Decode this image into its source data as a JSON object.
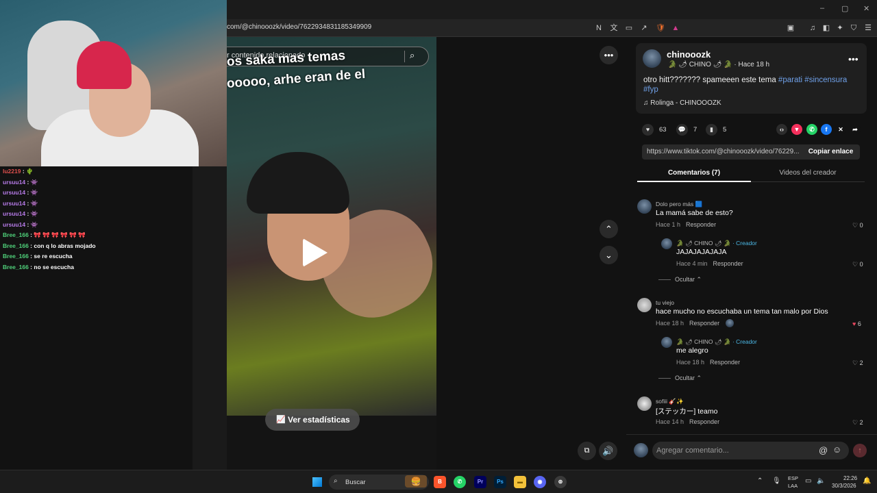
{
  "browser": {
    "url": "com/@chinooozk/video/7622934831185349909",
    "window_controls": [
      "–",
      "▢",
      "✕"
    ]
  },
  "chat": [
    {
      "user": "lu2219",
      "msg": "🌵",
      "color": "#e0504d"
    },
    {
      "user": "ursuu14",
      "msg": "👾",
      "color": "#b77be8"
    },
    {
      "user": "ursuu14",
      "msg": "👾",
      "color": "#b77be8"
    },
    {
      "user": "ursuu14",
      "msg": "👾",
      "color": "#b77be8"
    },
    {
      "user": "ursuu14",
      "msg": "👾",
      "color": "#b77be8"
    },
    {
      "user": "ursuu14",
      "msg": "👾",
      "color": "#b77be8"
    },
    {
      "user": "Bree_166",
      "msg": "🎀 🎀 🎀 🎀 🎀 🎀",
      "color": "#4fd17a"
    },
    {
      "user": "Bree_166",
      "msg": "con q lo abras mojado",
      "color": "#4fd17a"
    },
    {
      "user": "Bree_166",
      "msg": "se re escucha",
      "color": "#4fd17a"
    },
    {
      "user": "Bree_166",
      "msg": "no se escucha",
      "color": "#4fd17a"
    }
  ],
  "video": {
    "related_search": "r contenido relacionado",
    "caption_line1": "os saka mas temas",
    "caption_line2": "ooooo, arhe eran de el",
    "stats_button": "Ver estadísticas"
  },
  "post": {
    "author": "chinooozk",
    "author_sub": "🐊 🌶 CHINO 🌶 🐊 · Hace 18 h",
    "desc_text": "otro hitt??????? spameeen este tema ",
    "tags": [
      "#parati",
      "#sincensura",
      "#fyp"
    ],
    "music": "Rolinga - CHINOOOZK",
    "likes": "63",
    "comments": "7",
    "saves": "5",
    "link": "https://www.tiktok.com/@chinooozk/video/76229...",
    "copy_label": "Copiar enlace"
  },
  "tabs": {
    "comments": "Comentarios (7)",
    "videos": "Videos del creador"
  },
  "comments": [
    {
      "user": "Dolo pero más 🟦",
      "text": "La mamá sabe de esto?",
      "time": "Hace 1 h",
      "reply": "Responder",
      "likes": "0"
    },
    {
      "user": "🐊 🌶 CHINO 🌶 🐊",
      "creator": "· Creador",
      "text": "JAJAJAJAJAJA",
      "time": "Hace 4 min",
      "reply": "Responder",
      "likes": "0"
    },
    {
      "user": "tu viejo",
      "text": "hace mucho no escuchaba un tema tan malo por Dios",
      "time": "Hace 18 h",
      "reply": "Responder",
      "likes": "6"
    },
    {
      "user": "🐊 🌶 CHINO 🌶 🐊",
      "creator": "· Creador",
      "text": "me alegro",
      "time": "Hace 18 h",
      "reply": "Responder",
      "likes": "2"
    },
    {
      "user": "sofiii 🎸✨",
      "text": "[ステッカー] teamo",
      "time": "Hace 14 h",
      "reply": "Responder",
      "likes": "2"
    }
  ],
  "hide_label": "Ocultar",
  "composer": {
    "placeholder": "Agregar comentario..."
  },
  "taskbar": {
    "search": "Buscar",
    "lang1": "ESP",
    "lang2": "LAA",
    "time": "22:26",
    "date": "30/3/2026"
  },
  "colors": {
    "accent_tag": "#6fa0e8",
    "creator": "#4bb8e6",
    "liked": "#e8475f"
  }
}
